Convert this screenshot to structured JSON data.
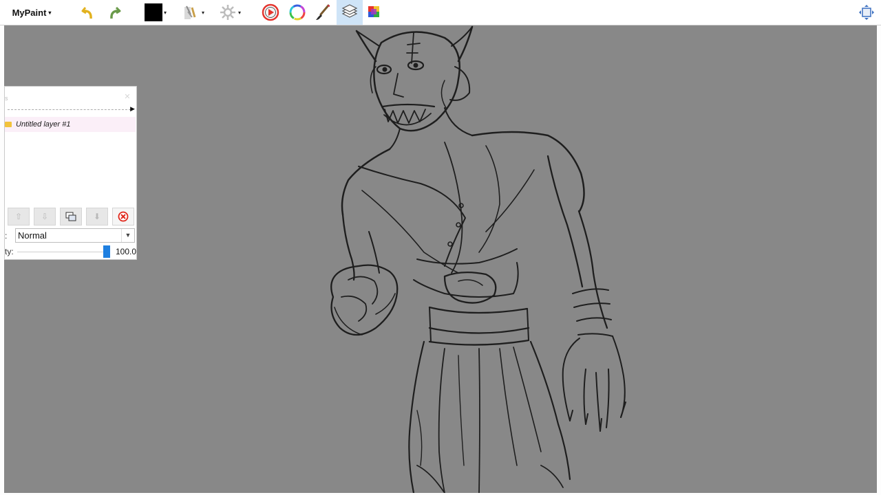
{
  "app": {
    "menu_label": "MyPaint",
    "caret": "▾"
  },
  "toolbar": {
    "undo_icon": "undo-arrow-icon",
    "redo_icon": "redo-arrow-icon",
    "active_color": "#000000",
    "brush_modes_icon": "brush-modes-icon",
    "symmetry_icon": "symmetry-gear-icon",
    "color_wheel_icon": "color-picker-icon",
    "hue_ring_icon": "hue-ring-icon",
    "brush_icon": "brush-icon",
    "layers_icon": "layers-icon",
    "palette_icon": "palette-icon",
    "fullscreen_icon": "fullscreen-icon"
  },
  "layers_panel": {
    "stub_text": "s",
    "layers": [
      {
        "name": "Untitled layer #1",
        "selected": true
      }
    ],
    "mode_label": ":",
    "mode_value": "Normal",
    "opacity_label": "ty:",
    "opacity_value": "100.0",
    "opacity_level": 1.0
  },
  "colors": {
    "canvas_bg": "#888888",
    "selected_layer_bg": "#fbeff8",
    "slider_accent": "#1e7fe0",
    "delete_red": "#e0261a"
  }
}
